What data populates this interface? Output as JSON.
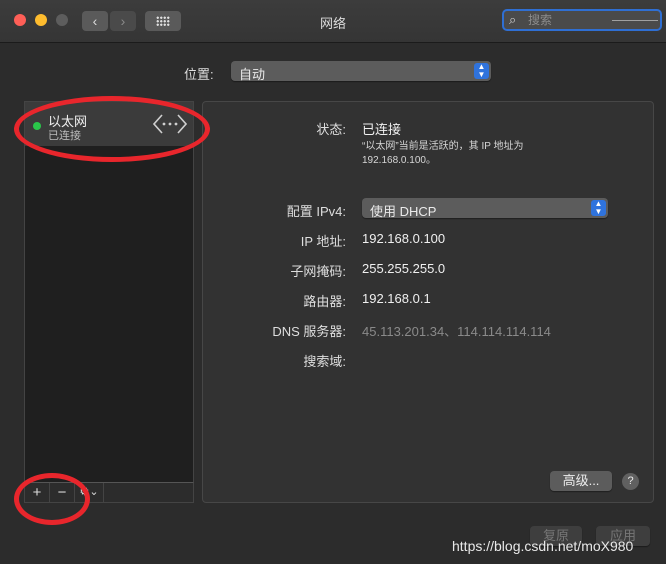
{
  "window": {
    "title": "网络"
  },
  "toolbar": {
    "back_glyph": "‹",
    "forward_glyph": "›",
    "search_placeholder": "搜索"
  },
  "location": {
    "label": "位置:",
    "value": "自动"
  },
  "services": [
    {
      "name": "以太网",
      "status": "已连接",
      "status_color": "#2ac64a",
      "icon": "ethernet-icon"
    }
  ],
  "sidebar_tools": {
    "add": "+",
    "remove": "−",
    "action": "⚙⌄"
  },
  "details": {
    "status_label": "状态:",
    "status_value": "已连接",
    "status_desc": "“以太网”当前是活跃的，其 IP 地址为 192.168.0.100。",
    "configure_label": "配置 IPv4:",
    "configure_value": "使用 DHCP",
    "ip_label": "IP 地址:",
    "ip_value": "192.168.0.100",
    "subnet_label": "子网掩码:",
    "subnet_value": "255.255.255.0",
    "router_label": "路由器:",
    "router_value": "192.168.0.1",
    "dns_label": "DNS 服务器:",
    "dns_value": "45.113.201.34、114.114.114.114",
    "search_domains_label": "搜索域:"
  },
  "buttons": {
    "advanced": "高级...",
    "help": "?",
    "revert": "复原",
    "apply": "应用"
  },
  "watermark": "https://blog.csdn.net/moX980"
}
